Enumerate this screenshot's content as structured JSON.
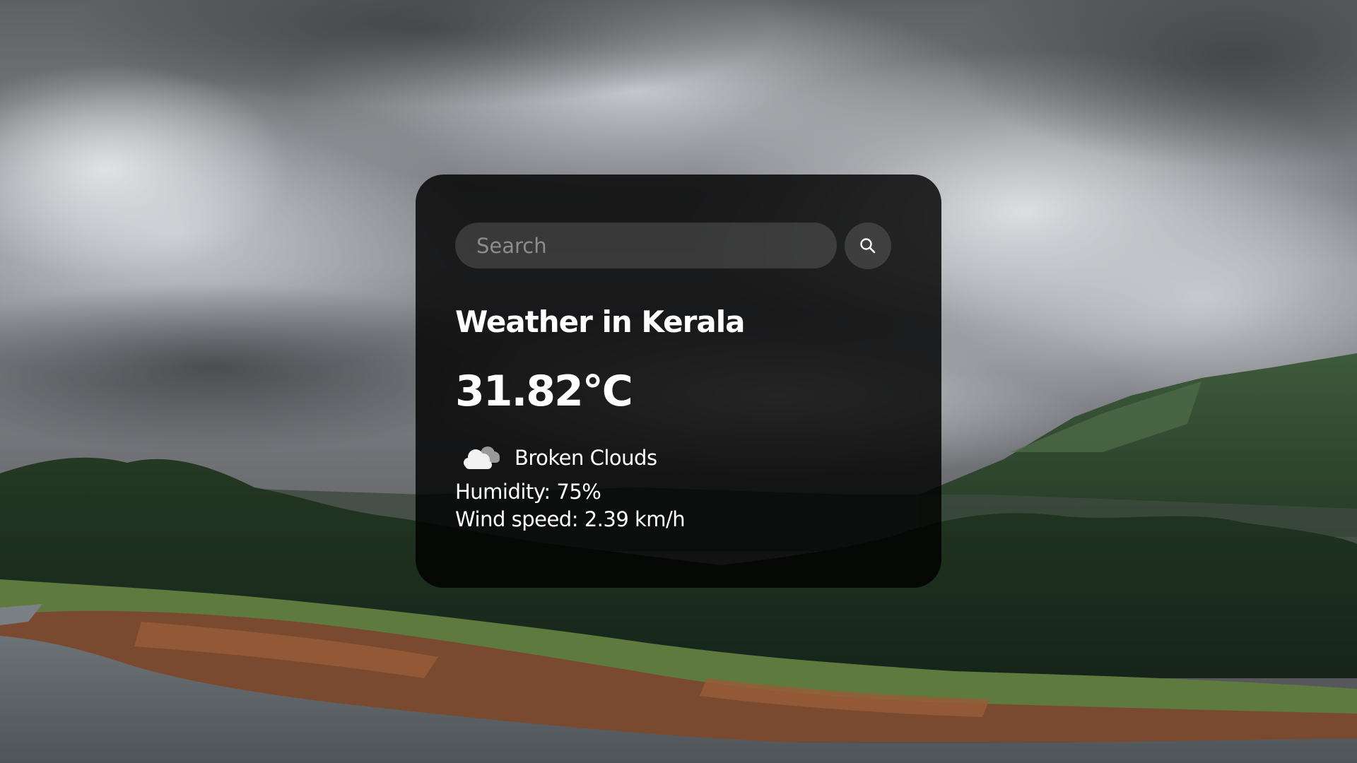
{
  "search": {
    "placeholder": "Search",
    "value": ""
  },
  "weather": {
    "title": "Weather in Kerala",
    "temperature": "31.82°C",
    "condition": "Broken Clouds",
    "condition_icon": "broken-clouds-icon",
    "humidity": "Humidity: 75%",
    "wind": "Wind speed: 2.39 km/h"
  },
  "colors": {
    "card_background": "#000000",
    "text": "#ffffff",
    "placeholder": "#8d8d8d"
  }
}
